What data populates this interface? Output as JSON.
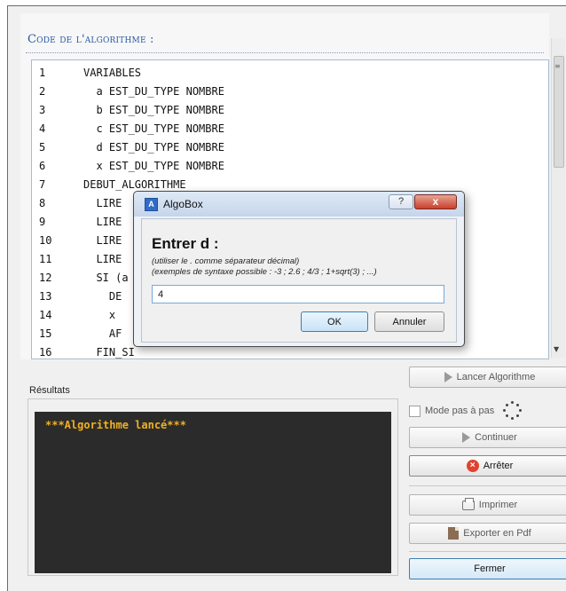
{
  "code_section": {
    "heading": "Code de l'algorithme :",
    "lines": [
      {
        "num": "1",
        "text": "VARIABLES"
      },
      {
        "num": "2",
        "text": "  a EST_DU_TYPE NOMBRE"
      },
      {
        "num": "3",
        "text": "  b EST_DU_TYPE NOMBRE"
      },
      {
        "num": "4",
        "text": "  c EST_DU_TYPE NOMBRE"
      },
      {
        "num": "5",
        "text": "  d EST_DU_TYPE NOMBRE"
      },
      {
        "num": "6",
        "text": "  x EST_DU_TYPE NOMBRE"
      },
      {
        "num": "7",
        "text": "DEBUT_ALGORITHME"
      },
      {
        "num": "8",
        "text": "  LIRE"
      },
      {
        "num": "9",
        "text": "  LIRE"
      },
      {
        "num": "10",
        "text": "  LIRE"
      },
      {
        "num": "11",
        "text": "  LIRE"
      },
      {
        "num": "12",
        "text": "  SI (a"
      },
      {
        "num": "13",
        "text": "    DE"
      },
      {
        "num": "14",
        "text": "    x"
      },
      {
        "num": "15",
        "text": "    AF"
      },
      {
        "num": "16",
        "text": "  FIN_SI"
      }
    ]
  },
  "results": {
    "label": "Résultats",
    "console_text": "***Algorithme lancé***"
  },
  "side_panel": {
    "run_button": "Lancer Algorithme",
    "step_mode_label": "Mode pas à pas",
    "continue_button": "Continuer",
    "stop_button": "Arrêter",
    "print_button": "Imprimer",
    "export_pdf_button": "Exporter en Pdf",
    "close_button": "Fermer"
  },
  "dialog": {
    "title": "AlgoBox",
    "help_label": "?",
    "close_label": "x",
    "prompt": "Entrer d :",
    "hint_line1": "(utiliser le . comme séparateur décimal)",
    "hint_line2": "(exemples de syntaxe possible : -3 ; 2.6 ; 4/3 ; 1+sqrt(3) ; ...)",
    "input_value": "4",
    "ok_button": "OK",
    "cancel_button": "Annuler"
  },
  "icons": {
    "app": "algobox-app-icon",
    "run": "play-icon",
    "stop": "stop-icon",
    "print": "printer-icon",
    "pdf": "pdf-icon",
    "spinner": "spinner-icon"
  },
  "colors": {
    "console_bg": "#2b2b2b",
    "console_text": "#f0b020",
    "heading": "#2a5aa4",
    "stop_icon": "#e2432e"
  }
}
